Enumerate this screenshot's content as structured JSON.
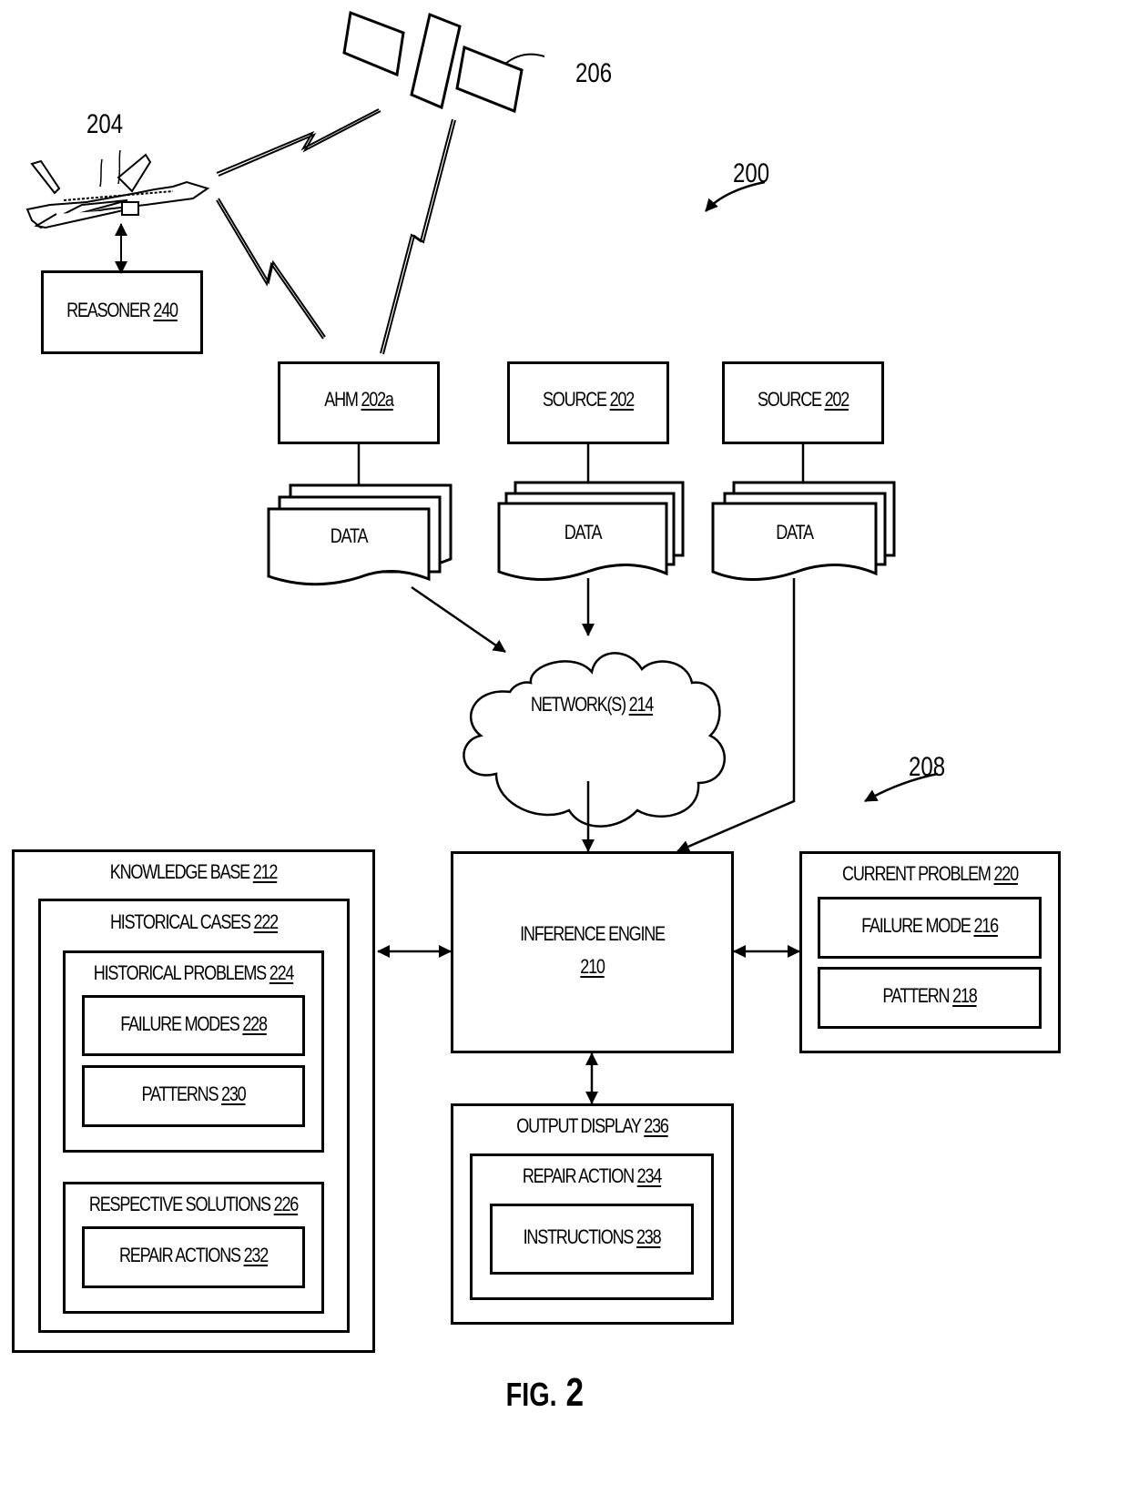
{
  "figure": {
    "label": "FIG.",
    "number": "2"
  },
  "refs": {
    "system": "200",
    "aircraft": "204",
    "satellite": "206",
    "analysis": "208"
  },
  "reasoner": {
    "text": "REASONER",
    "num": "240"
  },
  "sources": [
    {
      "text": "AHM",
      "num": "202a",
      "data_label": "DATA"
    },
    {
      "text": "SOURCE",
      "num": "202",
      "data_label": "DATA"
    },
    {
      "text": "SOURCE",
      "num": "202",
      "data_label": "DATA"
    }
  ],
  "network": {
    "text": "NETWORK(S)",
    "num": "214"
  },
  "inference_engine": {
    "text": "INFERENCE ENGINE",
    "num": "210"
  },
  "knowledge_base": {
    "text": "KNOWLEDGE BASE",
    "num": "212",
    "historical_cases": {
      "text": "HISTORICAL CASES",
      "num": "222"
    },
    "historical_problems": {
      "text": "HISTORICAL PROBLEMS",
      "num": "224"
    },
    "failure_modes": {
      "text": "FAILURE MODES",
      "num": "228"
    },
    "patterns": {
      "text": "PATTERNS",
      "num": "230"
    },
    "respective_solutions": {
      "text": "RESPECTIVE SOLUTIONS",
      "num": "226"
    },
    "repair_actions": {
      "text": "REPAIR ACTIONS",
      "num": "232"
    }
  },
  "current_problem": {
    "text": "CURRENT PROBLEM",
    "num": "220",
    "failure_mode": {
      "text": "FAILURE MODE",
      "num": "216"
    },
    "pattern": {
      "text": "PATTERN",
      "num": "218"
    }
  },
  "output_display": {
    "text": "OUTPUT DISPLAY",
    "num": "236",
    "repair_action": {
      "text": "REPAIR ACTION",
      "num": "234"
    },
    "instructions": {
      "text": "INSTRUCTIONS",
      "num": "238"
    }
  }
}
